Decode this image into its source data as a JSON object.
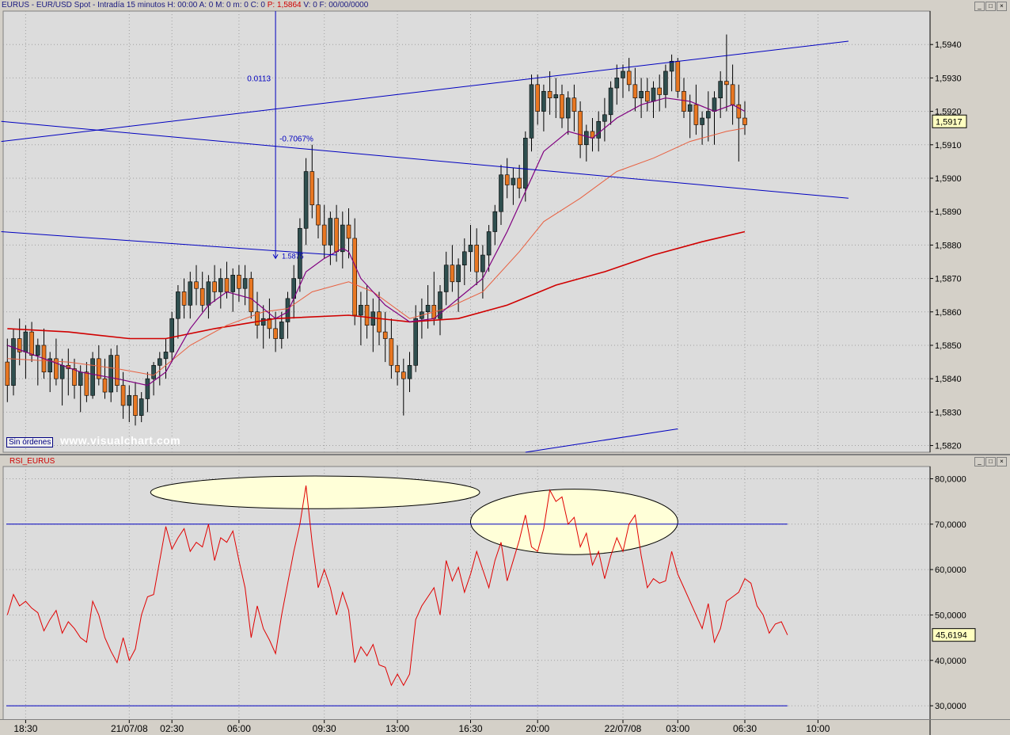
{
  "header": {
    "symbol": "EURUS",
    "title": "EURUS - EUR/USD Spot - Intradía 15 minutos",
    "h": "H: 00:00",
    "a": "A: 0",
    "m": "M: 0",
    "mm": "m: 0",
    "c": "C: 0",
    "p_label": "P: 1,5864",
    "v": "V: 0",
    "f": "F: 00/00/0000"
  },
  "buttons": {
    "minimize": "_",
    "maximize": "□",
    "close": "×"
  },
  "orders_badge": "Sin órdenes",
  "watermark": "www.visualchart.com",
  "colors": {
    "up": "#2f4f4f",
    "down": "#e87722",
    "wick": "#000000",
    "ma_fast": "#800080",
    "ma_mid": "#e86040",
    "ma_slow": "#d00000",
    "trend": "#0000c0",
    "rsi": "#e00000",
    "grid": "#a0a0a0"
  },
  "chart_data": [
    {
      "type": "candlestick",
      "title": "EURUS - EUR/USD Spot - Intradía 15 minutos",
      "y_ticks": [
        "1,5820",
        "1,5830",
        "1,5840",
        "1,5850",
        "1,5860",
        "1,5870",
        "1,5880",
        "1,5890",
        "1,5900",
        "1,5910",
        "1,5920",
        "1,5930",
        "1,5940"
      ],
      "ylim": [
        1.5818,
        1.595
      ],
      "last_price_label": "1,5917",
      "annotations": [
        "0.0113",
        "-0.7067%",
        "1.5875"
      ],
      "candles": [
        [
          1.5845,
          1.5852,
          1.5833,
          1.5838
        ],
        [
          1.5838,
          1.5855,
          1.5835,
          1.5852
        ],
        [
          1.5852,
          1.5858,
          1.5844,
          1.5848
        ],
        [
          1.5848,
          1.5856,
          1.584,
          1.5854
        ],
        [
          1.5854,
          1.5857,
          1.5845,
          1.5847
        ],
        [
          1.5847,
          1.5852,
          1.5838,
          1.585
        ],
        [
          1.585,
          1.5855,
          1.584,
          1.5842
        ],
        [
          1.5842,
          1.5848,
          1.5836,
          1.5846
        ],
        [
          1.5846,
          1.5852,
          1.5838,
          1.584
        ],
        [
          1.584,
          1.5846,
          1.5832,
          1.5844
        ],
        [
          1.5844,
          1.5849,
          1.5835,
          1.5843
        ],
        [
          1.5843,
          1.5846,
          1.5834,
          1.5838
        ],
        [
          1.5838,
          1.5844,
          1.583,
          1.5842
        ],
        [
          1.5842,
          1.5845,
          1.5833,
          1.5835
        ],
        [
          1.5835,
          1.5848,
          1.5834,
          1.5846
        ],
        [
          1.5846,
          1.585,
          1.5838,
          1.584
        ],
        [
          1.584,
          1.5846,
          1.5834,
          1.5836
        ],
        [
          1.5836,
          1.5849,
          1.5833,
          1.5847
        ],
        [
          1.5847,
          1.585,
          1.5836,
          1.5838
        ],
        [
          1.5838,
          1.5842,
          1.5828,
          1.5832
        ],
        [
          1.5832,
          1.5838,
          1.5827,
          1.5835
        ],
        [
          1.5835,
          1.5839,
          1.5826,
          1.5829
        ],
        [
          1.5829,
          1.5836,
          1.5827,
          1.5834
        ],
        [
          1.5834,
          1.5842,
          1.583,
          1.584
        ],
        [
          1.584,
          1.5845,
          1.5835,
          1.5844
        ],
        [
          1.5844,
          1.5848,
          1.5838,
          1.5846
        ],
        [
          1.5846,
          1.5852,
          1.584,
          1.5848
        ],
        [
          1.5848,
          1.586,
          1.5845,
          1.5858
        ],
        [
          1.5858,
          1.5868,
          1.5852,
          1.5866
        ],
        [
          1.5866,
          1.587,
          1.5858,
          1.5862
        ],
        [
          1.5862,
          1.5872,
          1.5858,
          1.5869
        ],
        [
          1.5869,
          1.5874,
          1.5862,
          1.5867
        ],
        [
          1.5867,
          1.5872,
          1.586,
          1.5862
        ],
        [
          1.5862,
          1.5871,
          1.5858,
          1.5869
        ],
        [
          1.5869,
          1.5874,
          1.5863,
          1.5866
        ],
        [
          1.5866,
          1.5873,
          1.5861,
          1.587
        ],
        [
          1.587,
          1.5875,
          1.5864,
          1.5866
        ],
        [
          1.5866,
          1.5873,
          1.586,
          1.5871
        ],
        [
          1.5871,
          1.5874,
          1.5863,
          1.5867
        ],
        [
          1.5867,
          1.5874,
          1.5862,
          1.587
        ],
        [
          1.587,
          1.5872,
          1.5858,
          1.586
        ],
        [
          1.586,
          1.5866,
          1.5852,
          1.5856
        ],
        [
          1.5856,
          1.5862,
          1.5849,
          1.5858
        ],
        [
          1.5858,
          1.5864,
          1.5852,
          1.5855
        ],
        [
          1.5855,
          1.586,
          1.5848,
          1.5852
        ],
        [
          1.5852,
          1.586,
          1.5849,
          1.5857
        ],
        [
          1.5857,
          1.5866,
          1.5852,
          1.5864
        ],
        [
          1.5864,
          1.5874,
          1.5858,
          1.587
        ],
        [
          1.587,
          1.5888,
          1.5866,
          1.5885
        ],
        [
          1.5885,
          1.5906,
          1.588,
          1.5902
        ],
        [
          1.5902,
          1.591,
          1.5888,
          1.5892
        ],
        [
          1.5892,
          1.59,
          1.5882,
          1.5886
        ],
        [
          1.5886,
          1.5892,
          1.5876,
          1.588
        ],
        [
          1.588,
          1.589,
          1.5874,
          1.5888
        ],
        [
          1.5888,
          1.5892,
          1.5875,
          1.5878
        ],
        [
          1.5878,
          1.589,
          1.5873,
          1.5886
        ],
        [
          1.5886,
          1.5891,
          1.5876,
          1.5882
        ],
        [
          1.5882,
          1.5888,
          1.5856,
          1.5859
        ],
        [
          1.5859,
          1.5866,
          1.585,
          1.5862
        ],
        [
          1.5862,
          1.5868,
          1.5852,
          1.5856
        ],
        [
          1.5856,
          1.5864,
          1.5848,
          1.586
        ],
        [
          1.586,
          1.5866,
          1.585,
          1.5854
        ],
        [
          1.5854,
          1.586,
          1.5845,
          1.5852
        ],
        [
          1.5852,
          1.5858,
          1.584,
          1.5844
        ],
        [
          1.5844,
          1.585,
          1.5838,
          1.5842
        ],
        [
          1.5842,
          1.5846,
          1.5829,
          1.584
        ],
        [
          1.584,
          1.5848,
          1.5836,
          1.5844
        ],
        [
          1.5844,
          1.5862,
          1.5842,
          1.5858
        ],
        [
          1.5858,
          1.5864,
          1.5852,
          1.586
        ],
        [
          1.586,
          1.5868,
          1.5855,
          1.5862
        ],
        [
          1.5862,
          1.5872,
          1.5856,
          1.5858
        ],
        [
          1.5858,
          1.5868,
          1.5853,
          1.5866
        ],
        [
          1.5866,
          1.5878,
          1.5862,
          1.5874
        ],
        [
          1.5874,
          1.588,
          1.5866,
          1.5869
        ],
        [
          1.5869,
          1.5876,
          1.586,
          1.5874
        ],
        [
          1.5874,
          1.5882,
          1.5868,
          1.5878
        ],
        [
          1.5878,
          1.5886,
          1.5872,
          1.588
        ],
        [
          1.588,
          1.5885,
          1.5868,
          1.5872
        ],
        [
          1.5872,
          1.588,
          1.5864,
          1.5877
        ],
        [
          1.5877,
          1.5886,
          1.5872,
          1.5884
        ],
        [
          1.5884,
          1.5892,
          1.588,
          1.589
        ],
        [
          1.589,
          1.5904,
          1.5886,
          1.5901
        ],
        [
          1.5901,
          1.5906,
          1.5894,
          1.5898
        ],
        [
          1.5898,
          1.5903,
          1.5892,
          1.59
        ],
        [
          1.59,
          1.5904,
          1.5894,
          1.5897
        ],
        [
          1.5897,
          1.5914,
          1.5893,
          1.5912
        ],
        [
          1.5912,
          1.5931,
          1.5908,
          1.5928
        ],
        [
          1.5928,
          1.5931,
          1.5916,
          1.592
        ],
        [
          1.592,
          1.5928,
          1.5914,
          1.5926
        ],
        [
          1.5926,
          1.5932,
          1.5919,
          1.5924
        ],
        [
          1.5924,
          1.593,
          1.5918,
          1.5925
        ],
        [
          1.5925,
          1.5928,
          1.5915,
          1.5918
        ],
        [
          1.5918,
          1.5926,
          1.5913,
          1.5924
        ],
        [
          1.5924,
          1.5928,
          1.5914,
          1.592
        ],
        [
          1.592,
          1.5923,
          1.5906,
          1.591
        ],
        [
          1.591,
          1.5916,
          1.5905,
          1.5914
        ],
        [
          1.5914,
          1.5918,
          1.5908,
          1.5912
        ],
        [
          1.5912,
          1.592,
          1.5908,
          1.5917
        ],
        [
          1.5917,
          1.5924,
          1.5911,
          1.5919
        ],
        [
          1.5919,
          1.5929,
          1.5916,
          1.5927
        ],
        [
          1.5927,
          1.5934,
          1.5922,
          1.593
        ],
        [
          1.593,
          1.5934,
          1.5924,
          1.5932
        ],
        [
          1.5932,
          1.5936,
          1.5926,
          1.5928
        ],
        [
          1.5928,
          1.5933,
          1.592,
          1.5924
        ],
        [
          1.5924,
          1.593,
          1.5918,
          1.5926
        ],
        [
          1.5926,
          1.593,
          1.592,
          1.5923
        ],
        [
          1.5923,
          1.5929,
          1.5918,
          1.5927
        ],
        [
          1.5927,
          1.5931,
          1.592,
          1.5925
        ],
        [
          1.5925,
          1.5934,
          1.5921,
          1.5932
        ],
        [
          1.5932,
          1.5937,
          1.5926,
          1.5935
        ],
        [
          1.5935,
          1.5936,
          1.5924,
          1.5926
        ],
        [
          1.5926,
          1.593,
          1.5918,
          1.592
        ],
        [
          1.592,
          1.5925,
          1.5912,
          1.5922
        ],
        [
          1.5922,
          1.5928,
          1.5913,
          1.5916
        ],
        [
          1.5916,
          1.592,
          1.591,
          1.5918
        ],
        [
          1.5918,
          1.5926,
          1.5911,
          1.592
        ],
        [
          1.592,
          1.5926,
          1.591,
          1.5924
        ],
        [
          1.5924,
          1.5932,
          1.5918,
          1.5929
        ],
        [
          1.5929,
          1.5943,
          1.592,
          1.5928
        ],
        [
          1.5928,
          1.5934,
          1.5916,
          1.5922
        ],
        [
          1.5922,
          1.5928,
          1.5905,
          1.5918
        ],
        [
          1.5918,
          1.5923,
          1.5913,
          1.5916
        ]
      ],
      "ma_fast": [
        [
          0,
          1.585
        ],
        [
          6,
          1.5846
        ],
        [
          12,
          1.5842
        ],
        [
          18,
          1.584
        ],
        [
          23,
          1.5838
        ],
        [
          26,
          1.5842
        ],
        [
          30,
          1.5855
        ],
        [
          33,
          1.5862
        ],
        [
          36,
          1.5866
        ],
        [
          40,
          1.5864
        ],
        [
          44,
          1.5858
        ],
        [
          46,
          1.586
        ],
        [
          49,
          1.5872
        ],
        [
          52,
          1.5876
        ],
        [
          55,
          1.5879
        ],
        [
          56,
          1.5878
        ],
        [
          58,
          1.587
        ],
        [
          62,
          1.5862
        ],
        [
          66,
          1.5857
        ],
        [
          70,
          1.5858
        ],
        [
          74,
          1.5864
        ],
        [
          78,
          1.587
        ],
        [
          82,
          1.5884
        ],
        [
          85,
          1.5896
        ],
        [
          88,
          1.5908
        ],
        [
          92,
          1.5914
        ],
        [
          96,
          1.5912
        ],
        [
          100,
          1.5918
        ],
        [
          104,
          1.5922
        ],
        [
          108,
          1.5924
        ],
        [
          112,
          1.5923
        ],
        [
          116,
          1.592
        ],
        [
          119,
          1.5922
        ],
        [
          121,
          1.592
        ]
      ],
      "ma_mid": [
        [
          0,
          1.5846
        ],
        [
          10,
          1.5845
        ],
        [
          18,
          1.5843
        ],
        [
          24,
          1.5841
        ],
        [
          30,
          1.585
        ],
        [
          36,
          1.5856
        ],
        [
          42,
          1.586
        ],
        [
          46,
          1.5861
        ],
        [
          50,
          1.5866
        ],
        [
          56,
          1.5869
        ],
        [
          60,
          1.5866
        ],
        [
          66,
          1.5858
        ],
        [
          72,
          1.5861
        ],
        [
          78,
          1.5866
        ],
        [
          84,
          1.5878
        ],
        [
          88,
          1.5887
        ],
        [
          94,
          1.5894
        ],
        [
          100,
          1.5902
        ],
        [
          106,
          1.5906
        ],
        [
          112,
          1.5911
        ],
        [
          118,
          1.5914
        ],
        [
          121,
          1.5915
        ]
      ],
      "ma_slow": [
        [
          0,
          1.5855
        ],
        [
          10,
          1.5854
        ],
        [
          20,
          1.5852
        ],
        [
          26,
          1.5852
        ],
        [
          34,
          1.5855
        ],
        [
          44,
          1.5858
        ],
        [
          56,
          1.5859
        ],
        [
          66,
          1.5857
        ],
        [
          74,
          1.5858
        ],
        [
          82,
          1.5862
        ],
        [
          90,
          1.5868
        ],
        [
          98,
          1.5872
        ],
        [
          106,
          1.5877
        ],
        [
          114,
          1.5881
        ],
        [
          121,
          1.5884
        ]
      ],
      "trendlines": [
        [
          [
            -1,
            1.5911
          ],
          [
            138,
            1.5941
          ]
        ],
        [
          [
            -1,
            1.5917
          ],
          [
            138,
            1.5894
          ]
        ],
        [
          [
            -1,
            1.5884
          ],
          [
            54,
            1.5877
          ]
        ],
        [
          [
            85,
            1.5818
          ],
          [
            110,
            1.5825
          ]
        ]
      ],
      "measure": [
        [
          44,
          1.595
        ],
        [
          44,
          1.5876
        ]
      ]
    },
    {
      "type": "line",
      "title": "RSI_EURUS",
      "y_ticks": [
        "30,0000",
        "40,0000",
        "50,0000",
        "60,0000",
        "70,0000",
        "80,0000"
      ],
      "ylim": [
        26.7,
        82.7
      ],
      "levels": [
        70,
        30
      ],
      "last_value_label": "45,6194",
      "values": [
        50,
        54.5,
        52,
        53,
        51.5,
        50.5,
        46.5,
        49,
        51,
        46,
        48.5,
        47,
        45,
        44,
        53,
        50,
        45,
        42,
        39.5,
        45,
        40,
        42.5,
        50,
        54,
        54.5,
        62,
        69.5,
        64.5,
        67,
        69,
        64,
        66,
        65,
        70,
        62,
        67,
        66,
        68.5,
        62,
        56,
        45,
        52,
        47,
        44.5,
        41.5,
        50,
        57,
        64,
        70,
        78.5,
        66,
        56,
        60,
        56,
        50,
        55,
        51,
        39.5,
        43,
        41,
        43.5,
        39,
        38.5,
        34.5,
        37,
        34.5,
        37,
        49,
        52,
        54,
        56,
        50,
        62,
        57.5,
        60.5,
        55,
        59,
        64,
        60,
        56,
        62,
        66,
        57.5,
        62,
        66.5,
        72,
        65,
        64,
        69,
        77.5,
        75,
        76,
        70,
        71.5,
        65,
        68,
        61,
        64,
        58,
        63,
        67,
        64,
        70,
        72,
        63,
        56,
        58,
        57,
        57.5,
        64,
        59,
        56,
        53,
        50,
        47,
        52.5,
        44,
        47,
        53,
        54,
        55,
        58,
        57,
        52,
        50,
        46,
        48,
        48.5,
        45.6
      ],
      "ellipses": [
        [
          50.5,
          77,
          27,
          3.6
        ],
        [
          93,
          70.5,
          17,
          7.2
        ]
      ]
    }
  ],
  "time_labels": [
    {
      "i": 3,
      "label": "18:30"
    },
    {
      "i": 20,
      "label": "21/07/08"
    },
    {
      "i": 27,
      "label": "02:30"
    },
    {
      "i": 38,
      "label": "06:00"
    },
    {
      "i": 52,
      "label": "09:30"
    },
    {
      "i": 64,
      "label": "13:00"
    },
    {
      "i": 76,
      "label": "16:30"
    },
    {
      "i": 87,
      "label": "20:00"
    },
    {
      "i": 101,
      "label": "22/07/08"
    },
    {
      "i": 110,
      "label": "03:00"
    },
    {
      "i": 121,
      "label": "06:30"
    },
    {
      "i": 133,
      "label": "10:00"
    }
  ]
}
